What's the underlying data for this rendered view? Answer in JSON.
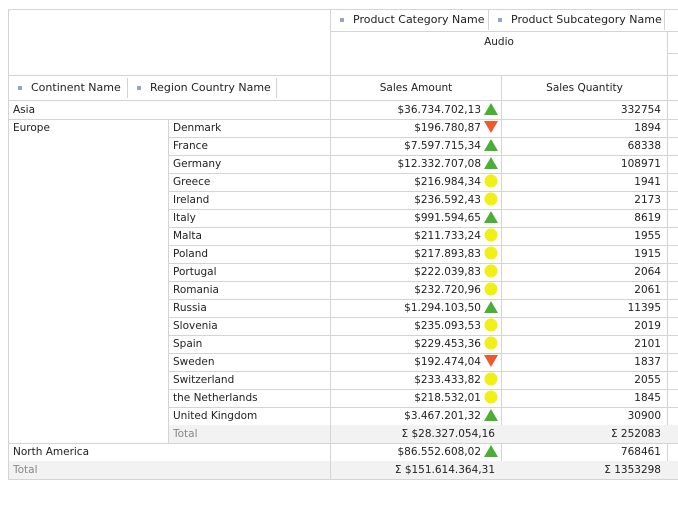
{
  "column_fields": [
    {
      "label": "Product Category Name"
    },
    {
      "label": "Product Subcategory Name"
    }
  ],
  "row_fields": [
    {
      "label": "Continent Name"
    },
    {
      "label": "Region Country Name"
    }
  ],
  "column_header": {
    "category": "Audio",
    "measures": [
      "Sales Amount",
      "Sales Quantity"
    ]
  },
  "colors": {
    "up": "#4caf35",
    "down": "#ee5a2c",
    "neutral": "#f0f016",
    "grid_line": "#d4d4d4",
    "total_bg": "#f2f2f2",
    "field_dot": "#9aa3c7"
  },
  "rows": [
    {
      "continent": "Asia",
      "country": "",
      "amount": "$36.734.702,13",
      "indicator": "up",
      "quantity": "332754"
    },
    {
      "continent": "Europe",
      "country": "Denmark",
      "amount": "$196.780,87",
      "indicator": "down",
      "quantity": "1894"
    },
    {
      "continent": "",
      "country": "France",
      "amount": "$7.597.715,34",
      "indicator": "up",
      "quantity": "68338"
    },
    {
      "continent": "",
      "country": "Germany",
      "amount": "$12.332.707,08",
      "indicator": "up",
      "quantity": "108971"
    },
    {
      "continent": "",
      "country": "Greece",
      "amount": "$216.984,34",
      "indicator": "neutral",
      "quantity": "1941"
    },
    {
      "continent": "",
      "country": "Ireland",
      "amount": "$236.592,43",
      "indicator": "neutral",
      "quantity": "2173"
    },
    {
      "continent": "",
      "country": "Italy",
      "amount": "$991.594,65",
      "indicator": "up",
      "quantity": "8619"
    },
    {
      "continent": "",
      "country": "Malta",
      "amount": "$211.733,24",
      "indicator": "neutral",
      "quantity": "1955"
    },
    {
      "continent": "",
      "country": "Poland",
      "amount": "$217.893,83",
      "indicator": "neutral",
      "quantity": "1915"
    },
    {
      "continent": "",
      "country": "Portugal",
      "amount": "$222.039,83",
      "indicator": "neutral",
      "quantity": "2064"
    },
    {
      "continent": "",
      "country": "Romania",
      "amount": "$232.720,96",
      "indicator": "neutral",
      "quantity": "2061"
    },
    {
      "continent": "",
      "country": "Russia",
      "amount": "$1.294.103,50",
      "indicator": "up",
      "quantity": "11395"
    },
    {
      "continent": "",
      "country": "Slovenia",
      "amount": "$235.093,53",
      "indicator": "neutral",
      "quantity": "2019"
    },
    {
      "continent": "",
      "country": "Spain",
      "amount": "$229.453,36",
      "indicator": "neutral",
      "quantity": "2101"
    },
    {
      "continent": "",
      "country": "Sweden",
      "amount": "$192.474,04",
      "indicator": "down",
      "quantity": "1837"
    },
    {
      "continent": "",
      "country": "Switzerland",
      "amount": "$233.433,82",
      "indicator": "neutral",
      "quantity": "2055"
    },
    {
      "continent": "",
      "country": "the Netherlands",
      "amount": "$218.532,01",
      "indicator": "neutral",
      "quantity": "1845"
    },
    {
      "continent": "",
      "country": "United Kingdom",
      "amount": "$3.467.201,32",
      "indicator": "up",
      "quantity": "30900"
    },
    {
      "continent": "",
      "country": "Total",
      "amount": "Σ $28.327.054,16",
      "indicator": "",
      "quantity": "Σ 252083",
      "subtotal": true
    },
    {
      "continent": "North America",
      "country": "",
      "amount": "$86.552.608,02",
      "indicator": "up",
      "quantity": "768461"
    },
    {
      "continent": "Total",
      "country": "",
      "amount": "Σ $151.614.364,31",
      "indicator": "",
      "quantity": "Σ 1353298",
      "grand_total": true
    }
  ]
}
